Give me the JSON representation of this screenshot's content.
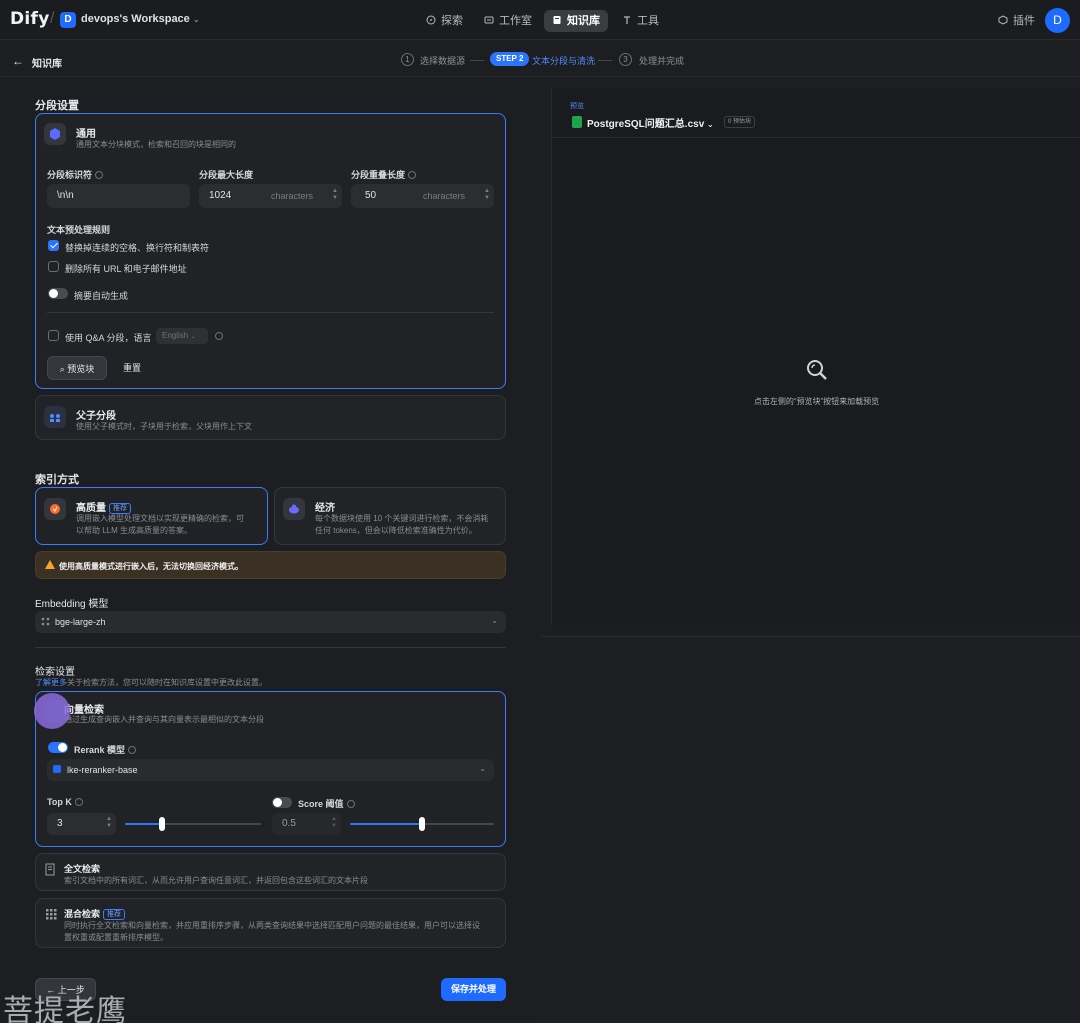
{
  "app": {
    "logo": "Dify",
    "workspace_badge": "D",
    "workspace_name": "devops's Workspace",
    "nav": [
      {
        "label": "探索",
        "icon": "compass-icon"
      },
      {
        "label": "工作室",
        "icon": "studio-icon"
      },
      {
        "label": "知识库",
        "icon": "book-icon"
      },
      {
        "label": "工具",
        "icon": "tool-icon"
      }
    ],
    "plugins_label": "插件",
    "avatar": "D"
  },
  "subnav": {
    "back_label": "知识库",
    "steps": [
      {
        "num": "1",
        "label": "选择数据源"
      },
      {
        "pill": "STEP 2",
        "label": "文本分段与清洗"
      },
      {
        "num": "3",
        "label": "处理并完成"
      }
    ]
  },
  "segment": {
    "title": "分段设置",
    "general": {
      "title": "通用",
      "desc": "通用文本分块模式，检索和召回的块是相同的",
      "delimiter_label": "分段标识符",
      "delimiter_value": "\\n\\n",
      "max_len_label": "分段最大长度",
      "max_len_value": "1024",
      "overlap_label": "分段重叠长度",
      "overlap_value": "50",
      "unit": "characters",
      "rules_title": "文本预处理规则",
      "rule_spaces": "替换掉连续的空格、换行符和制表符",
      "rule_urls": "删除所有 URL 和电子邮件地址",
      "auto_summary": "摘要自动生成",
      "qa_label": "使用 Q&A 分段，语言",
      "qa_language": "English",
      "preview_btn": "预览块",
      "reset_btn": "重置"
    },
    "parent_child": {
      "title": "父子分段",
      "desc": "使用父子模式时，子块用于检索，父块用作上下文"
    }
  },
  "index": {
    "title": "索引方式",
    "high_quality": {
      "title": "高质量",
      "badge": "推荐",
      "desc1": "调用嵌入模型处理文档以实现更精确的检索，可",
      "desc2": "以帮助 LLM 生成高质量的答案。"
    },
    "economy": {
      "title": "经济",
      "desc1": "每个数据块使用 10 个关键词进行检索，不会消耗",
      "desc2": "任何 tokens，但会以降低检索准确性为代价。"
    },
    "warning": "使用高质量模式进行嵌入后，无法切换回经济模式。"
  },
  "embedding": {
    "title": "Embedding 模型",
    "model": "bge-large-zh"
  },
  "retrieval": {
    "title": "检索设置",
    "link": "了解更多",
    "link_desc": "关于检索方法，您可以随时在知识库设置中更改此设置。",
    "vector": {
      "title": "向量检索",
      "desc": "通过生成查询嵌入并查询与其向量表示最相似的文本分段"
    },
    "rerank_label": "Rerank 模型",
    "rerank_model": "lke-reranker-base",
    "topk_label": "Top K",
    "topk_value": "3",
    "topk_fraction": 0.27,
    "score_label": "Score 阈值",
    "score_value": "0.5",
    "score_fraction": 0.5,
    "fulltext": {
      "title": "全文检索",
      "desc": "索引文档中的所有词汇，从而允许用户查询任意词汇，并返回包含这些词汇的文本片段"
    },
    "hybrid": {
      "title": "混合检索",
      "badge": "推荐",
      "desc1": "同时执行全文检索和向量检索，并应用重排序步骤，从两类查询结果中选择匹配用户问题的最佳结果，用户可以选择设",
      "desc2": "置权重或配置重新排序模型。"
    }
  },
  "footer": {
    "prev_btn": "上一步",
    "save_btn": "保存并处理"
  },
  "preview": {
    "label": "预览",
    "file": "PostgreSQL问题汇总.csv",
    "count": "0 预估块",
    "empty_hint": "点击左侧的“预览块”按钮来加载预览"
  },
  "watermark": "菩提老鹰"
}
